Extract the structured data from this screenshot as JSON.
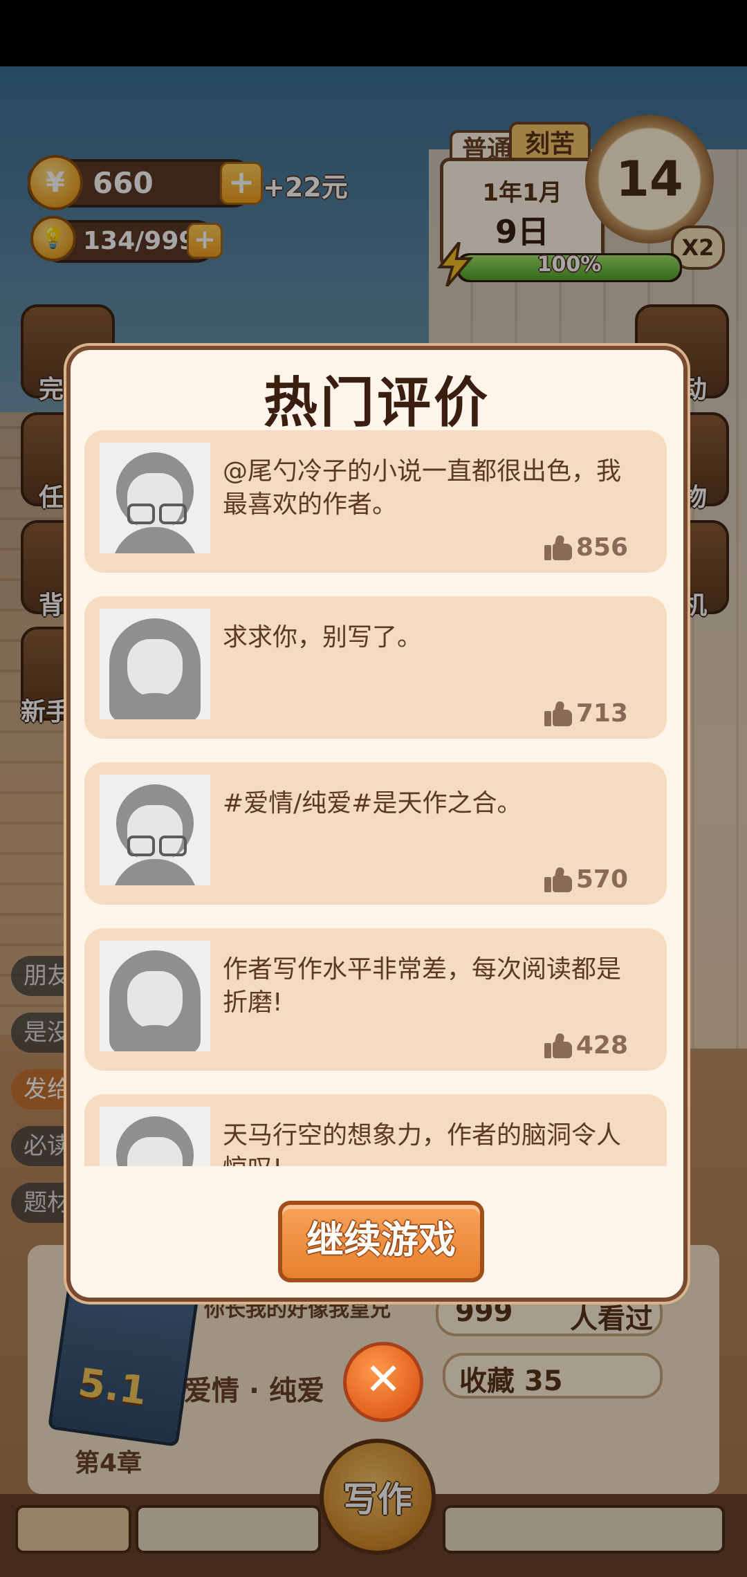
{
  "hud": {
    "coins": "660",
    "money_plus": "+22元",
    "inspiration": "134/999",
    "mode_normal": "普通",
    "mode_hard": "刻苦",
    "date_month": "1年1月",
    "date_day": "9日",
    "clock_value": "14",
    "multiplier": "X2",
    "energy_percent": "100%",
    "energy_fraction": 1.0
  },
  "side_buttons": {
    "left": [
      "完",
      "任",
      "背",
      "新手"
    ],
    "right": [
      "动",
      "物",
      "机"
    ]
  },
  "left_chips": [
    "朋友",
    "是没",
    "发给",
    "必读",
    "题材"
  ],
  "modal": {
    "title": "热门评价",
    "reviews": [
      {
        "avatar": "male-glasses-avatar",
        "text": "@尾勺冷子的小说一直都很出色，我最喜欢的作者。",
        "likes": "856"
      },
      {
        "avatar": "female-avatar",
        "text": "求求你，别写了。",
        "likes": "713"
      },
      {
        "avatar": "male-glasses-avatar",
        "text": "#爱情/纯爱#是天作之合。",
        "likes": "570"
      },
      {
        "avatar": "female-avatar",
        "text": "作者写作水平非常差，每次阅读都是折磨!",
        "likes": "428"
      },
      {
        "avatar": "male-glasses-avatar",
        "text": "天马行空的想象力，作者的脑洞令人惊叹!",
        "likes": ""
      }
    ],
    "continue_label": "继续游戏"
  },
  "book": {
    "rating": "5.1",
    "title": "你长我的好像我皇兄",
    "genre": "爱情 · 纯爱",
    "viewers_count": "999",
    "viewers_label": "人看过",
    "favorites": "收藏 35",
    "chapter": "第4章",
    "write_label": "写作"
  }
}
